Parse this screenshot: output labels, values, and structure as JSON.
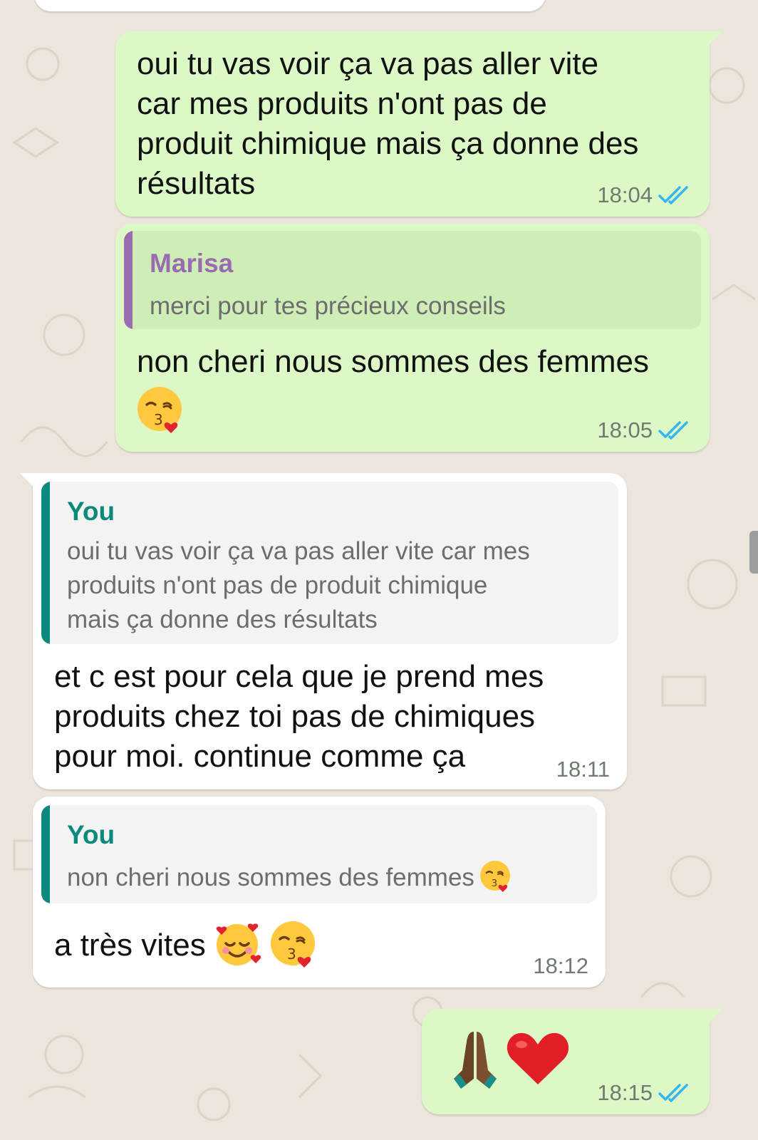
{
  "colors": {
    "outgoing_bubble": "#dcf8c6",
    "incoming_bubble": "#ffffff",
    "read_ticks": "#34b7f1",
    "quote_marisa": "#9b6bb0",
    "quote_you": "#0b8a7c",
    "background": "#ece5dc"
  },
  "messages": [
    {
      "direction": "out",
      "text": "oui tu vas voir ça va pas aller vite\ncar mes produits n'ont pas de\nproduit chimique mais ça donne des\nrésultats",
      "time": "18:04",
      "status_icon": "double-check-read-icon"
    },
    {
      "direction": "out",
      "quote_author": "Marisa",
      "quote_text": "merci pour tes précieux conseils",
      "text": "non cheri nous sommes des femmes",
      "emoji": "face-blowing-kiss-emoji",
      "time": "18:05",
      "status_icon": "double-check-read-icon"
    },
    {
      "direction": "in",
      "quote_author": "You",
      "quote_text": "oui tu vas voir ça va pas aller vite car mes\nproduits n'ont pas de produit chimique\nmais ça donne des résultats",
      "text": "et c est pour cela que je prend mes\nproduits chez toi pas de chimiques\npour moi. continue comme ça",
      "time": "18:11"
    },
    {
      "direction": "in",
      "quote_author": "You",
      "quote_text": "non cheri nous sommes des femmes",
      "quote_emoji": "face-blowing-kiss-emoji",
      "text": "a très vites",
      "emojis": [
        "smiling-face-with-hearts-emoji",
        "face-blowing-kiss-emoji"
      ],
      "time": "18:12"
    },
    {
      "direction": "out",
      "emojis": [
        "folded-hands-emoji",
        "red-heart-emoji"
      ],
      "time": "18:15",
      "status_icon": "double-check-read-icon"
    }
  ]
}
